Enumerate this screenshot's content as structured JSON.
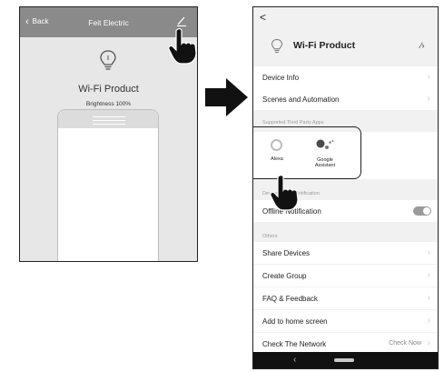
{
  "left_screen": {
    "back_label": "Back",
    "title": "Feit Electric",
    "device_name": "Wi-Fi Product",
    "brightness": "Brightness 100%"
  },
  "right_screen": {
    "back": "<",
    "device_name": "Wi-Fi Product",
    "menu_top": [
      {
        "label": "Device Info"
      },
      {
        "label": "Scenes and Automation"
      }
    ],
    "third_party_section": "Supported Third Party Apps",
    "apps": [
      {
        "name": "Alexa",
        "icon": "alexa-ring-icon"
      },
      {
        "name_line1": "Google",
        "name_line2": "Assistant",
        "icon": "google-assistant-icon"
      }
    ],
    "notification_section": "Device Offline Notification",
    "offline_notification": "Offline Notification",
    "offline_notification_on": true,
    "others_section": "Others",
    "menu_others": [
      {
        "label": "Share Devices"
      },
      {
        "label": "Create Group"
      },
      {
        "label": "FAQ & Feedback"
      },
      {
        "label": "Add to home screen"
      }
    ],
    "check_network": {
      "label": "Check The Network",
      "value": "Check Now"
    }
  },
  "colors": {
    "header_gray": "#8a8a8a",
    "arrow": "#111111",
    "toggle": "#9a9a9a",
    "google_blue": "#4a4a4a"
  }
}
